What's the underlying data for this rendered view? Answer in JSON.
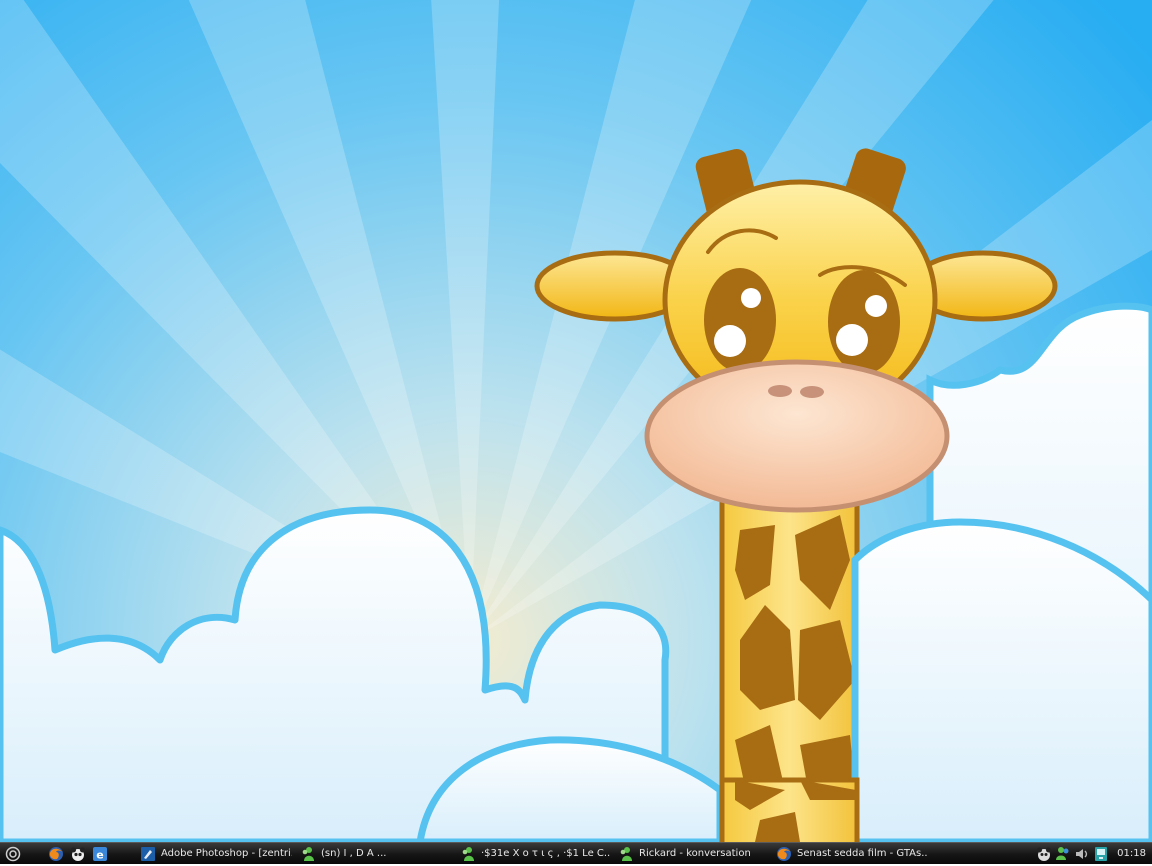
{
  "wallpaper": {
    "subject": "giraffe-clouds-sunburst",
    "colors": {
      "sky_top": "#2fb3f3",
      "sky_glow": "#f2ecd2",
      "cloud": "#ffffff",
      "cloud_outline": "#55c2f0",
      "giraffe_yellow": "#f7c51a",
      "giraffe_brown": "#a86c12",
      "muzzle": "#f3c0a0"
    }
  },
  "taskbar": {
    "start_icon": "start-orb-icon",
    "quick_launch": [
      {
        "name": "firefox-icon"
      },
      {
        "name": "panda-icon"
      },
      {
        "name": "internet-explorer-icon"
      }
    ],
    "tasks": [
      {
        "icon": "photoshop-icon",
        "label": "Adobe Photoshop - [zentri...",
        "width": 160
      },
      {
        "icon": "messenger-icon",
        "label": "(sn)    I    ,    D    A   ...",
        "width": 160
      },
      {
        "icon": "messenger-icon",
        "label": "·$31e Χ ο τ ι ς , ·$1 Le C...",
        "width": 158
      },
      {
        "icon": "messenger-icon",
        "label": "Rickard - konversation",
        "width": 158
      },
      {
        "icon": "firefox-icon",
        "label": "Senast sedda film - GTAs...",
        "width": 160
      }
    ],
    "tray_icons": [
      "panda-tray-icon",
      "messenger-tray-icon",
      "volume-tray-icon",
      "network-tray-icon"
    ],
    "clock": "01:18"
  }
}
